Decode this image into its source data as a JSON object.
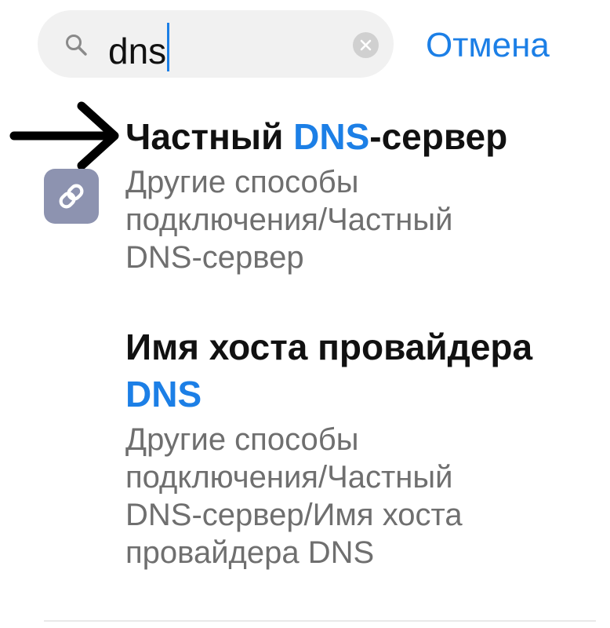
{
  "search": {
    "query": "dns",
    "cancel_label": "Отмена"
  },
  "results": [
    {
      "title_before": "Частный ",
      "title_highlight": "DNS",
      "title_after": "-сервер",
      "path": "Другие способы подключения/Частный DNS-сервер"
    },
    {
      "title_before": "Имя хоста провайдера ",
      "title_highlight": "DNS",
      "title_after": "",
      "path": "Другие способы подключения/Частный DNS-сервер/Имя хоста провайдера DNS"
    }
  ],
  "icons": {
    "search": "search-icon",
    "clear": "clear-icon",
    "app": "link-icon",
    "annotation": "arrow-right-icon"
  },
  "colors": {
    "accent": "#1c7fe6",
    "search_background": "#f1f1f1",
    "secondary_text": "#6f6f6f",
    "app_icon_background": "#8d93b0"
  }
}
